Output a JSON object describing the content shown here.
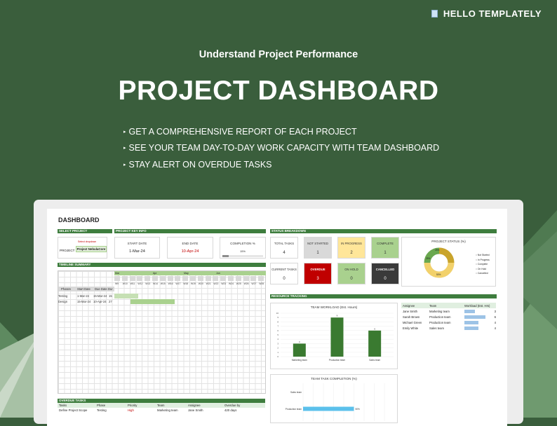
{
  "brand": {
    "name": "HELLO TEMPLATELY",
    "icon": "document-icon"
  },
  "hero": {
    "subtitle": "Understand Project Performance",
    "title": "PROJECT DASHBOARD",
    "bullets": [
      "GET A COMPREHENSIVE REPORT OF EACH PROJECT",
      "SEE YOUR TEAM DAY-TO-DAY WORK CAPACITY WITH TEAM DASHBOARD",
      "STAY ALERT ON OVERDUE TASKS"
    ]
  },
  "colors": {
    "bg": "#3a5e3c",
    "accent": "#3e7d3e"
  },
  "sheet": {
    "title": "DASHBOARD",
    "sections": {
      "select_project": "SELECT PROJECT",
      "key_info": "PROJECT KEY INFO",
      "status_breakdown": "STATUS BREAKDOWN",
      "timeline_summary": "TIMELINE SUMMARY",
      "resource_tracking": "RESOURCE TRACKING",
      "overdue_tasks": "OVERDUE TASKS"
    },
    "select": {
      "hint": "Select dropdown",
      "label": "PROJECT",
      "value": "Project NebulaCore"
    },
    "key_info": {
      "start_label": "START DATE",
      "start_value": "1-Mar-24",
      "end_label": "END DATE",
      "end_value": "10-Apr-24",
      "completion_label": "COMPLETION %",
      "completion_value": "15%",
      "completion_fraction": 0.15
    },
    "status_cards": [
      {
        "label": "TOTAL TASKS",
        "value": "4",
        "bg": "#ffffff",
        "fg": "#333333"
      },
      {
        "label": "NOT STARTED",
        "value": "1",
        "bg": "#d9d9d9",
        "fg": "#333333"
      },
      {
        "label": "IN PROGRESS",
        "value": "2",
        "bg": "#ffe699",
        "fg": "#333333"
      },
      {
        "label": "COMPLETE",
        "value": "1",
        "bg": "#a9d18e",
        "fg": "#333333"
      },
      {
        "label": "CURRENT TASKS",
        "value": "0",
        "bg": "#ffffff",
        "fg": "#333333"
      },
      {
        "label": "OVERDUE",
        "value": "3",
        "bg": "#c00000",
        "fg": "#ffffff"
      },
      {
        "label": "ON HOLD",
        "value": "0",
        "bg": "#a9d18e",
        "fg": "#333333"
      },
      {
        "label": "CANCELLED",
        "value": "0",
        "bg": "#3a3a3a",
        "fg": "#ffffff"
      }
    ],
    "timeline": {
      "months": [
        "Mar",
        "Apr",
        "May",
        "Jun"
      ],
      "weeks": [
        "W9",
        "W10",
        "W11",
        "W12",
        "W13",
        "W14",
        "W15",
        "W16",
        "W17",
        "W18",
        "W19",
        "W20",
        "W21",
        "W22",
        "W23",
        "W24",
        "W25",
        "W26",
        "W27",
        "W28"
      ],
      "headers": [
        "Phases",
        "Start Date",
        "Due Date",
        "Dur"
      ],
      "rows": [
        {
          "phase": "Testing",
          "start": "1-Mar-24",
          "due": "15-Mar-24",
          "dur": "15"
        },
        {
          "phase": "Design",
          "start": "15-Mar-24",
          "due": "10-Apr-24",
          "dur": "27"
        }
      ]
    },
    "donut": {
      "title": "PROJECT STATUS (%)",
      "legend": [
        "Not Started",
        "In Progress",
        "Complete",
        "On Hold",
        "Cancelled"
      ],
      "labels": [
        "25%",
        "50%",
        "25%"
      ]
    },
    "workload": {
      "title": "TEAM WORKLOAD (Est. Hours)",
      "teams": [
        {
          "team": "Marketing team",
          "hours": 3
        },
        {
          "team": "Production team",
          "hours": 9
        },
        {
          "team": "Sales team",
          "hours": 6
        }
      ],
      "yticks": [
        "0",
        "1",
        "2",
        "3",
        "4",
        "5",
        "6",
        "7",
        "8",
        "9",
        "10"
      ],
      "ylim": [
        0,
        10
      ]
    },
    "resource": {
      "headers": [
        "Assignee",
        "Team",
        "Workload (Est. Hrs)"
      ],
      "rows": [
        {
          "assignee": "Jane Smith",
          "team": "Marketing team",
          "hours": "3"
        },
        {
          "assignee": "Sarah Brown",
          "team": "Production team",
          "hours": "6"
        },
        {
          "assignee": "Michael Green",
          "team": "Production team",
          "hours": "4"
        },
        {
          "assignee": "Emily White",
          "team": "Sales team",
          "hours": "4"
        }
      ]
    },
    "completion_chart": {
      "title": "TEAM TASK COMPLETION (%)",
      "teams": [
        "Sales team",
        "Production team"
      ],
      "values": [
        0,
        50
      ],
      "labels": [
        "",
        "50%"
      ]
    },
    "overdue": {
      "headers": [
        "Tasks",
        "Phase",
        "Priority",
        "Team",
        "Assignee",
        "Overdue by"
      ],
      "rows": [
        {
          "task": "Define Project Scope",
          "phase": "Testing",
          "priority": "High",
          "team": "Marketing team",
          "assignee": "Jane Smith",
          "overdue": "420 days"
        }
      ]
    }
  },
  "chart_data": [
    {
      "type": "bar",
      "title": "TEAM WORKLOAD (Est. Hours)",
      "categories": [
        "Marketing team",
        "Production team",
        "Sales team"
      ],
      "values": [
        3,
        9,
        6
      ],
      "ylim": [
        0,
        10
      ]
    },
    {
      "type": "pie",
      "title": "PROJECT STATUS (%)",
      "categories": [
        "Not Started",
        "In Progress",
        "Complete"
      ],
      "values": [
        25,
        50,
        25
      ]
    },
    {
      "type": "bar",
      "title": "TEAM TASK COMPLETION (%)",
      "categories": [
        "Sales team",
        "Production team"
      ],
      "values": [
        0,
        50
      ]
    }
  ]
}
